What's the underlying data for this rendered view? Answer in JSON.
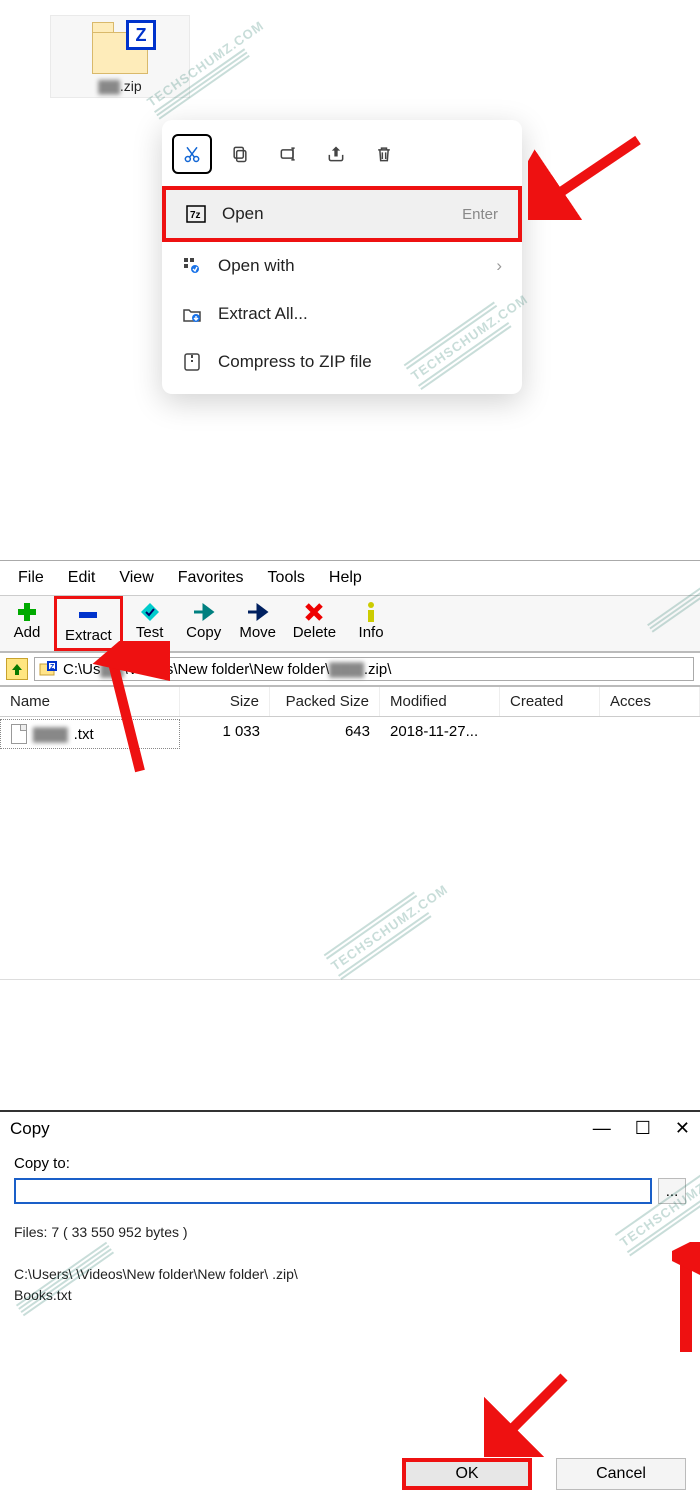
{
  "section1": {
    "file_ext": ".zip",
    "toolbar": [
      "cut",
      "copy",
      "rename",
      "share",
      "delete"
    ],
    "items": [
      {
        "icon": "7z",
        "label": "Open",
        "shortcut": "Enter"
      },
      {
        "icon": "openwith",
        "label": "Open with",
        "chevron": true
      },
      {
        "icon": "extract",
        "label": "Extract All..."
      },
      {
        "icon": "compress",
        "label": "Compress to ZIP file"
      }
    ]
  },
  "section2": {
    "menus": [
      "File",
      "Edit",
      "View",
      "Favorites",
      "Tools",
      "Help"
    ],
    "tools": [
      {
        "label": "Add",
        "color": "green-plus"
      },
      {
        "label": "Extract",
        "color": "blue-minus",
        "highlight": true
      },
      {
        "label": "Test",
        "color": "cyan-diamond"
      },
      {
        "label": "Copy",
        "color": "teal-arrow"
      },
      {
        "label": "Move",
        "color": "navy-arrow"
      },
      {
        "label": "Delete",
        "color": "red-x"
      },
      {
        "label": "Info",
        "color": "yellow-i"
      }
    ],
    "path_prefix": "C:\\Us",
    "path_mid": "\\Videos\\New folder\\New folder\\",
    "path_suffix": ".zip\\",
    "columns": [
      "Name",
      "Size",
      "Packed Size",
      "Modified",
      "Created",
      "Acces"
    ],
    "row": {
      "name_ext": ".txt",
      "size": "1 033",
      "psize": "643",
      "modified": "2018-11-27..."
    }
  },
  "section3": {
    "title": "Copy",
    "label": "Copy to:",
    "files_line": "Files: 7 ( 33 550 952 bytes )",
    "path_line": "C:\\Users\\       \\Videos\\New folder\\New folder\\        .zip\\",
    "file_line": "Books.txt",
    "ok": "OK",
    "cancel": "Cancel",
    "browse": "..."
  },
  "watermark": "TECHSCHUMZ.COM"
}
